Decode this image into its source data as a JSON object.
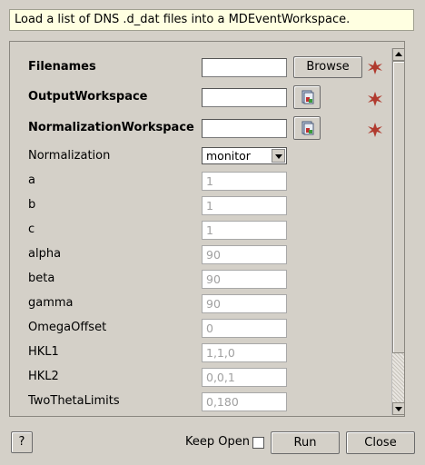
{
  "description": "Load a list of DNS .d_dat files into a MDEventWorkspace.",
  "properties": [
    {
      "label": "Filenames",
      "value": "",
      "bold": true,
      "kind": "browse",
      "button": "Browse",
      "required": true
    },
    {
      "label": "OutputWorkspace",
      "value": "",
      "bold": true,
      "kind": "workspace",
      "icon": "workspace-icon",
      "required": true
    },
    {
      "label": "NormalizationWorkspace",
      "value": "",
      "bold": true,
      "kind": "workspace",
      "icon": "workspace-icon",
      "required": true
    },
    {
      "label": "Normalization",
      "value": "monitor",
      "kind": "dropdown"
    },
    {
      "label": "a",
      "value": "1"
    },
    {
      "label": "b",
      "value": "1"
    },
    {
      "label": "c",
      "value": "1"
    },
    {
      "label": "alpha",
      "value": "90"
    },
    {
      "label": "beta",
      "value": "90"
    },
    {
      "label": "gamma",
      "value": "90"
    },
    {
      "label": "OmegaOffset",
      "value": "0"
    },
    {
      "label": "HKL1",
      "value": "1,1,0"
    },
    {
      "label": "HKL2",
      "value": "0,0,1"
    },
    {
      "label": "TwoThetaLimits",
      "value": "0,180"
    }
  ],
  "footer": {
    "help_label": "?",
    "keep_open_label": "Keep Open",
    "keep_open_checked": false,
    "run_label": "Run",
    "close_label": "Close"
  },
  "colors": {
    "required_star": "#b03a2e",
    "tooltip_bg": "#ffffe1"
  }
}
